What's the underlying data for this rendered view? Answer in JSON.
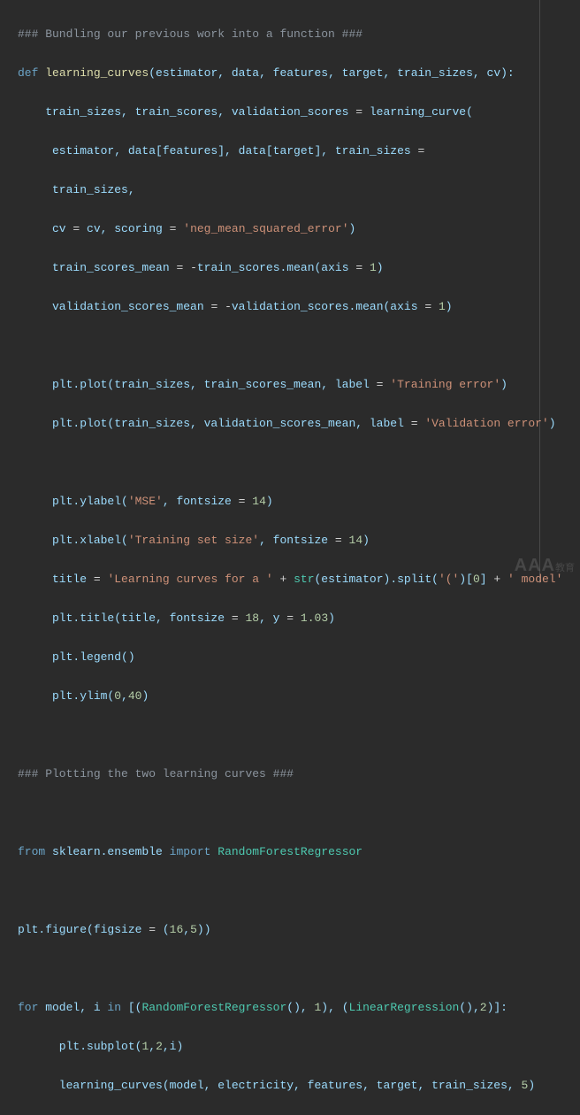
{
  "code": {
    "line1_comment": "### Bundling our previous work into a function ###",
    "def": "def",
    "fn_name": "learning_curves",
    "params": "(estimator, data, features, target, train_sizes, cv):",
    "l3a": "    train_sizes, train_scores, validation_scores ",
    "l3b": "=",
    "l3c": " learning_curve(",
    "l4": "     estimator, data[features], data[target], train_sizes ",
    "l4eq": "=",
    "l5": "     train_sizes,",
    "l6a": "     cv ",
    "l6eq": "=",
    "l6b": " cv, scoring ",
    "l6eq2": "=",
    "l6c": " ",
    "l6str": "'neg_mean_squared_error'",
    "l6end": ")",
    "l7a": "     train_scores_mean ",
    "l7eq": "=",
    "l7b": " ",
    "l7op": "-",
    "l7c": "train_scores.mean(axis ",
    "l7eq2": "=",
    "l7sp": " ",
    "l7num": "1",
    "l7end": ")",
    "l8a": "     validation_scores_mean ",
    "l8eq": "=",
    "l8b": " ",
    "l8op": "-",
    "l8c": "validation_scores.mean(axis ",
    "l8eq2": "=",
    "l8sp": " ",
    "l8num": "1",
    "l8end": ")",
    "l10a": "     plt.plot(train_sizes, train_scores_mean, label ",
    "l10eq": "=",
    "l10sp": " ",
    "l10str": "'Training error'",
    "l10end": ")",
    "l11a": "     plt.plot(train_sizes, validation_scores_mean, label ",
    "l11eq": "=",
    "l11sp": " ",
    "l11str": "'Validation error'",
    "l11end": ")",
    "l13a": "     plt.ylabel(",
    "l13str": "'MSE'",
    "l13b": ", fontsize ",
    "l13eq": "=",
    "l13sp": " ",
    "l13num": "14",
    "l13end": ")",
    "l14a": "     plt.xlabel(",
    "l14str": "'Training set size'",
    "l14b": ", fontsize ",
    "l14eq": "=",
    "l14sp": " ",
    "l14num": "14",
    "l14end": ")",
    "l15a": "     title ",
    "l15eq": "=",
    "l15sp": " ",
    "l15str1": "'Learning curves for a '",
    "l15plus1": " + ",
    "l15b": "str",
    "l15c": "(estimator).split(",
    "l15str2": "'('",
    "l15d": ")[",
    "l15num": "0",
    "l15e": "] ",
    "l15plus2": "+",
    "l15sp2": " ",
    "l15str3": "' model'",
    "l16a": "     plt.title(title, fontsize ",
    "l16eq": "=",
    "l16sp": " ",
    "l16num": "18",
    "l16b": ", y ",
    "l16eq2": "=",
    "l16sp2": " ",
    "l16num2": "1.03",
    "l16end": ")",
    "l17": "     plt.legend()",
    "l18a": "     plt.ylim(",
    "l18num1": "0",
    "l18c": ",",
    "l18num2": "40",
    "l18end": ")",
    "l20_comment": "### Plotting the two learning curves ###",
    "l22_from": "from",
    "l22_mod": " sklearn.ensemble ",
    "l22_import": "import",
    "l22_sp": " ",
    "l22_cls": "RandomForestRegressor",
    "l24a": "plt.figure(figsize ",
    "l24eq": "=",
    "l24b": " (",
    "l24num1": "16",
    "l24c": ",",
    "l24num2": "5",
    "l24end": "))",
    "l26_for": "for",
    "l26a": " model, i ",
    "l26_in": "in",
    "l26b": " [(",
    "l26cls1": "RandomForestRegressor",
    "l26c": "(), ",
    "l26num1": "1",
    "l26d": "), (",
    "l26cls2": "LinearRegression",
    "l26e": "(),",
    "l26num2": "2",
    "l26f": ")]:",
    "l27a": "      plt.subplot(",
    "l27num1": "1",
    "l27c1": ",",
    "l27num2": "2",
    "l27c2": ",i)",
    "l28a": "      learning_curves(model, electricity, features, target, train_sizes, ",
    "l28num": "5",
    "l28end": ")"
  },
  "watermark": {
    "big": "AAA",
    "small": "教育"
  }
}
